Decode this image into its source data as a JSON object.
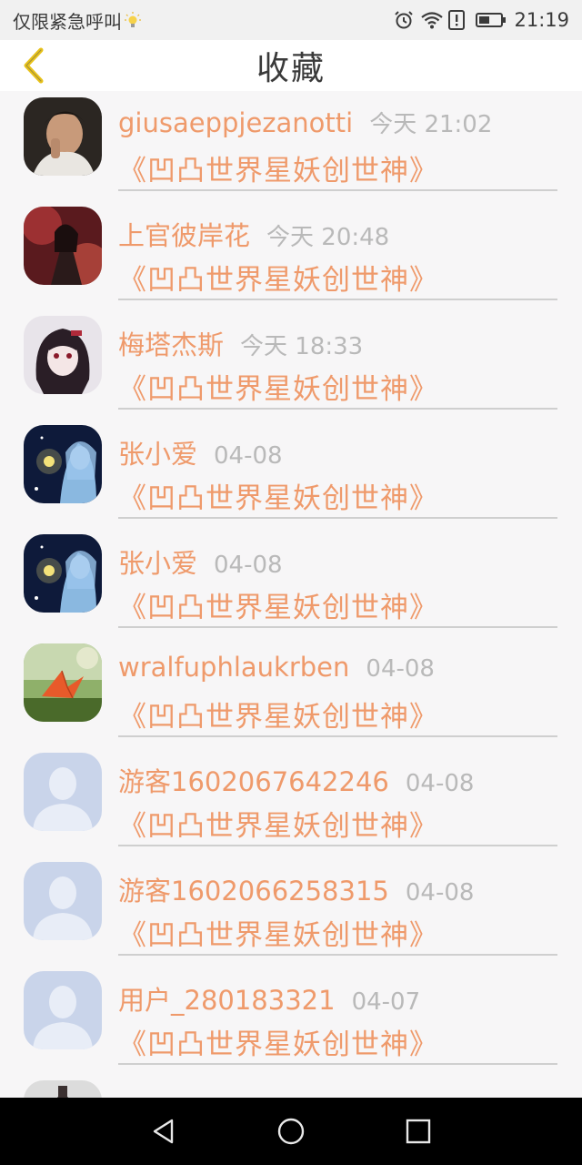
{
  "status_bar": {
    "left_text": "仅限紧急呼叫",
    "time": "21:19",
    "icons": [
      "lightbulb-icon",
      "alarm-icon",
      "wifi-icon",
      "warning-icon",
      "battery-icon"
    ]
  },
  "header": {
    "title": "收藏",
    "back_icon": "chevron-left-icon",
    "accent_color": "#e8c21a"
  },
  "colors": {
    "username": "#ef9a6b",
    "time": "#b9b9b9",
    "divider": "#cfcfcf"
  },
  "favorites": [
    {
      "username": "giusaeppjezanotti",
      "time": "今天 21:02",
      "book": "《凹凸世界星妖创世神》",
      "avatar": "photo-man"
    },
    {
      "username": "上官彼岸花",
      "time": "今天 20:48",
      "book": "《凹凸世界星妖创世神》",
      "avatar": "anime-red"
    },
    {
      "username": "梅塔杰斯",
      "time": "今天 18:33",
      "book": "《凹凸世界星妖创世神》",
      "avatar": "anime-dark"
    },
    {
      "username": "张小爱",
      "time": "04-08",
      "book": "《凹凸世界星妖创世神》",
      "avatar": "anime-blue"
    },
    {
      "username": "张小爱",
      "time": "04-08",
      "book": "《凹凸世界星妖创世神》",
      "avatar": "anime-blue"
    },
    {
      "username": "wralfuphlaukrben",
      "time": "04-08",
      "book": "《凹凸世界星妖创世神》",
      "avatar": "paper-crane"
    },
    {
      "username": "游客1602067642246",
      "time": "04-08",
      "book": "《凹凸世界星妖创世神》",
      "avatar": "default"
    },
    {
      "username": "游客1602066258315",
      "time": "04-08",
      "book": "《凹凸世界星妖创世神》",
      "avatar": "default"
    },
    {
      "username": "用户_280183321",
      "time": "04-07",
      "book": "《凹凸世界星妖创世神》",
      "avatar": "default"
    }
  ],
  "nav_bar": {
    "icons": [
      "back-triangle-icon",
      "home-circle-icon",
      "recents-square-icon"
    ]
  }
}
